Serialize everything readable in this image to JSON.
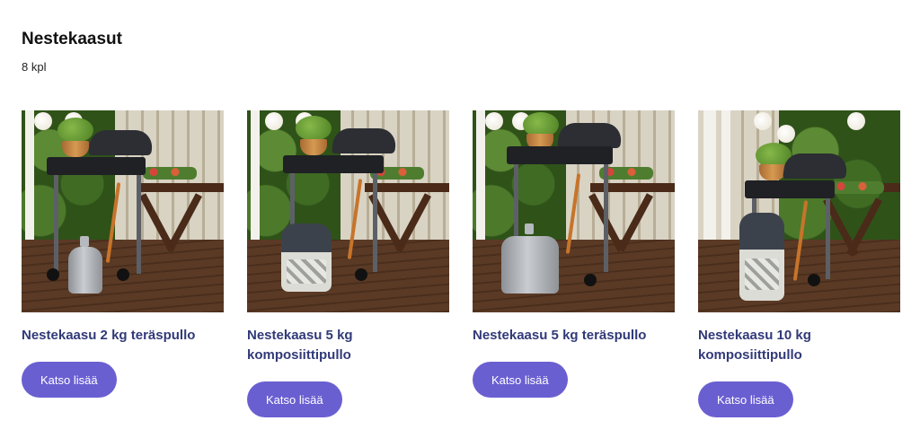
{
  "page": {
    "title": "Nestekaasut",
    "count": "8 kpl"
  },
  "products": [
    {
      "name": "Nestekaasu 2 kg teräspullo",
      "cta": "Katso lisää",
      "image": "grill-with-steel-gas-bottle-2kg"
    },
    {
      "name": "Nestekaasu 5 kg komposiittipullo",
      "cta": "Katso lisää",
      "image": "grill-with-composite-gas-bottle-5kg"
    },
    {
      "name": "Nestekaasu 5 kg teräspullo",
      "cta": "Katso lisää",
      "image": "grill-with-steel-gas-bottle-5kg"
    },
    {
      "name": "Nestekaasu 10 kg komposiittipullo",
      "cta": "Katso lisää",
      "image": "grill-with-composite-gas-bottle-10kg"
    }
  ],
  "colors": {
    "title": "#111111",
    "product_name": "#313a78",
    "button_bg": "#6a5fd1",
    "button_text": "#ffffff"
  }
}
